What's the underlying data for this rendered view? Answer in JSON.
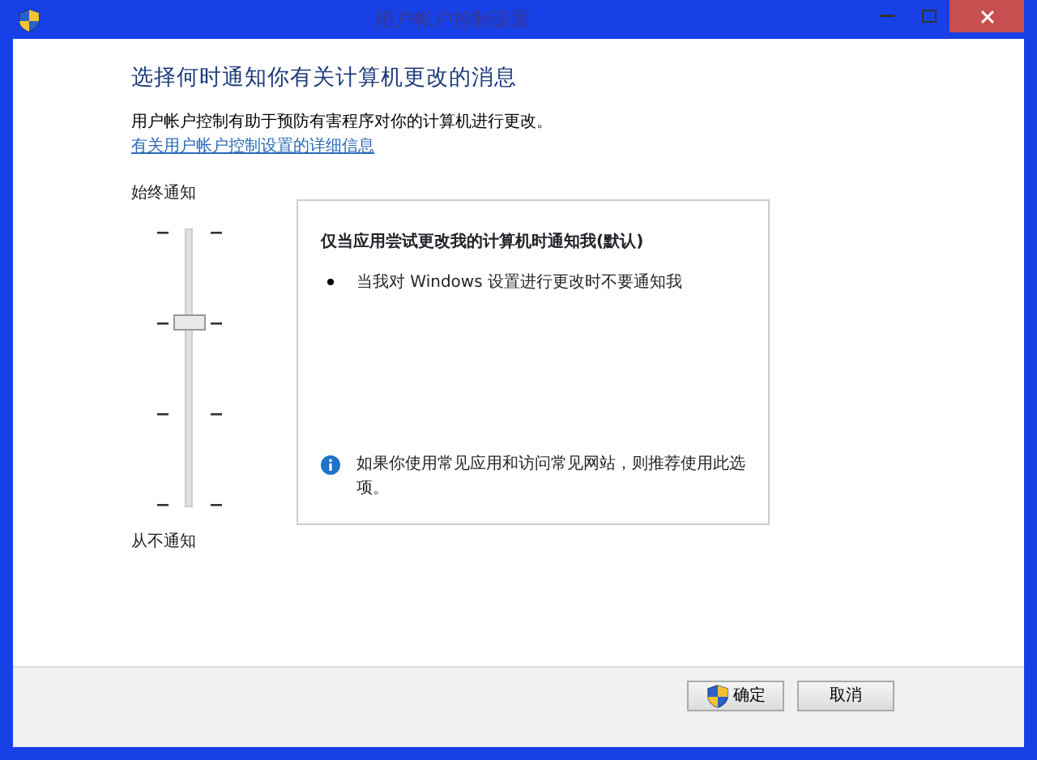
{
  "window": {
    "title": "用户帐户控制设置"
  },
  "heading": "选择何时通知你有关计算机更改的消息",
  "description": "用户帐户控制有助于预防有害程序对你的计算机进行更改。",
  "link": "有关用户帐户控制设置的详细信息",
  "slider": {
    "top_label": "始终通知",
    "bottom_label": "从不通知",
    "level": 0.667
  },
  "panel": {
    "title": "仅当应用尝试更改我的计算机时通知我(默认)",
    "bullets": [
      "当我对 Windows 设置进行更改时不要通知我"
    ],
    "note": "如果你使用常见应用和访问常见网站，则推荐使用此选项。"
  },
  "buttons": [
    {
      "label": "确定",
      "shield": true
    },
    {
      "label": "取消",
      "shield": false
    }
  ]
}
